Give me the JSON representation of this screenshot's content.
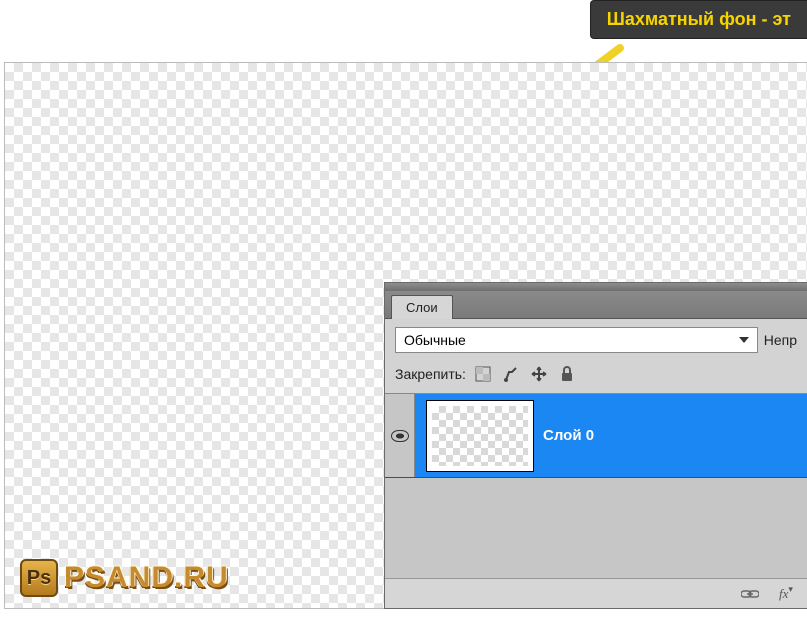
{
  "callout": {
    "text": "Шахматный фон - эт"
  },
  "watermark": {
    "badge": "Ps",
    "text": "PSAND.RU"
  },
  "layers_panel": {
    "tab_label": "Слои",
    "blend_mode": "Обычные",
    "opacity_label": "Непр",
    "lock_label": "Закрепить:",
    "layer_name": "Слой 0",
    "footer_fx": "fx"
  }
}
